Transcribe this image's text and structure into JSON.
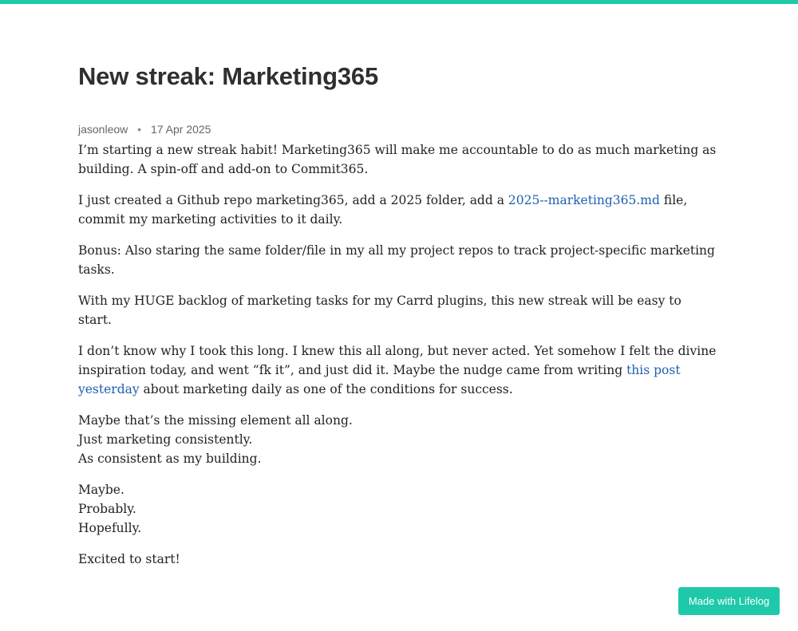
{
  "accent_color": "#1ec9a9",
  "link_color": "#1f5fb0",
  "post": {
    "title": "New streak: Marketing365",
    "author": "jasonleow",
    "separator": "•",
    "date": "17 Apr 2025",
    "p1": "I’m starting a new streak habit! Marketing365 will make me accountable to do as much marketing as building. A spin-off and add-on to Commit365.",
    "p2_before": "I just created a Github repo marketing365, add a 2025 folder, add a ",
    "p2_link": "2025--marketing365.md",
    "p2_after": " file, commit my marketing activities to it daily.",
    "p3": "Bonus: Also staring the same folder/file in my all my project repos to track project-specific marketing tasks.",
    "p4": "With my HUGE backlog of marketing tasks for my Carrd plugins, this new streak will be easy to start.",
    "p5_before": "I don’t know why I took this long. I knew this all along, but never acted. Yet somehow I felt the divine inspiration today, and went “fk it”, and just did it. Maybe the nudge came from writing ",
    "p5_link": "this post yesterday",
    "p5_after": " about marketing daily as one of the conditions for success.",
    "p6_lines": [
      "Maybe that’s the missing element all along.",
      "Just marketing consistently.",
      "As consistent as my building."
    ],
    "p7_lines": [
      "Maybe.",
      "Probably.",
      "Hopefully."
    ],
    "p8": "Excited to start!"
  },
  "badge": {
    "label": "Made with Lifelog"
  }
}
